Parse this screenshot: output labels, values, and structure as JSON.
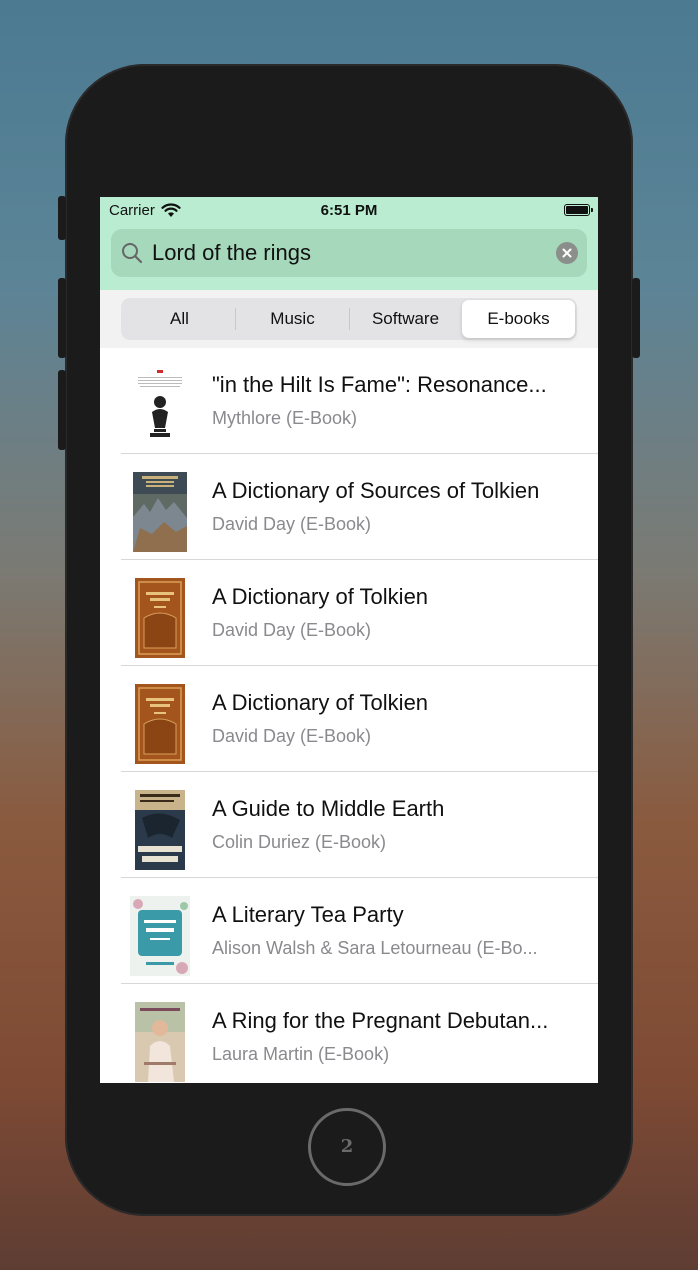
{
  "status_bar": {
    "carrier": "Carrier",
    "time": "6:51 PM"
  },
  "search": {
    "query": "Lord of the rings"
  },
  "segments": [
    {
      "label": "All",
      "selected": false
    },
    {
      "label": "Music",
      "selected": false
    },
    {
      "label": "Software",
      "selected": false
    },
    {
      "label": "E-books",
      "selected": true
    }
  ],
  "results": [
    {
      "title": "\"in the Hilt Is Fame\": Resonance...",
      "subtitle": "Mythlore (E-Book)"
    },
    {
      "title": "A Dictionary of Sources of Tolkien",
      "subtitle": "David Day (E-Book)"
    },
    {
      "title": "A Dictionary of Tolkien",
      "subtitle": "David Day (E-Book)"
    },
    {
      "title": "A Dictionary of Tolkien",
      "subtitle": "David Day (E-Book)"
    },
    {
      "title": "A Guide to Middle Earth",
      "subtitle": "Colin Duriez (E-Book)"
    },
    {
      "title": "A Literary Tea Party",
      "subtitle": "Alison Walsh & Sara Letourneau (E-Bo..."
    },
    {
      "title": "A Ring for the Pregnant Debutan...",
      "subtitle": "Laura Martin (E-Book)"
    }
  ],
  "home_button": {
    "label": "2"
  },
  "colors": {
    "header_bg": "#b9ecd0",
    "search_field_bg": "#a6d8bb"
  }
}
